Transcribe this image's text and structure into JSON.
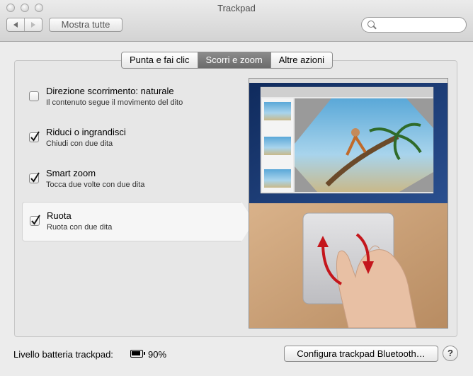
{
  "window": {
    "title": "Trackpad"
  },
  "toolbar": {
    "show_all_label": "Mostra tutte",
    "search_value": ""
  },
  "tabs": [
    {
      "label": "Punta e fai clic",
      "active": false
    },
    {
      "label": "Scorri e zoom",
      "active": true
    },
    {
      "label": "Altre azioni",
      "active": false
    }
  ],
  "options": [
    {
      "title": "Direzione scorrimento: naturale",
      "description": "Il contenuto segue il movimento del dito",
      "checked": false,
      "selected": false
    },
    {
      "title": "Riduci o ingrandisci",
      "description": "Chiudi con due dita",
      "checked": true,
      "selected": false
    },
    {
      "title": "Smart zoom",
      "description": "Tocca due volte con due dita",
      "checked": true,
      "selected": false
    },
    {
      "title": "Ruota",
      "description": "Ruota con due dita",
      "checked": true,
      "selected": true
    }
  ],
  "footer": {
    "battery_label": "Livello batteria trackpad:",
    "battery_value": "90%",
    "bluetooth_button": "Configura trackpad Bluetooth…",
    "help_label": "?"
  },
  "colors": {
    "active_tab": "#7a7a7a",
    "arrow": "#c4161c",
    "desktop_blue": "#1b3c7a"
  }
}
